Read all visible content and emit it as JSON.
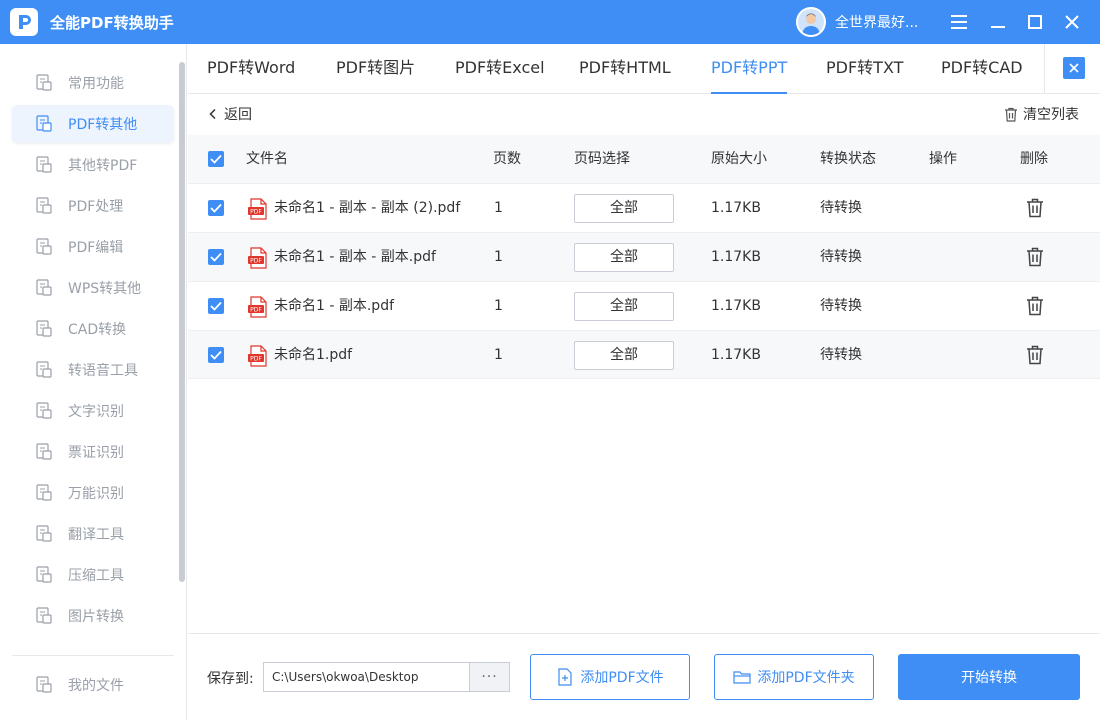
{
  "app": {
    "title": "全能PDF转换助手",
    "user_name": "全世界最好..."
  },
  "colors": {
    "accent": "#3e8ef5",
    "pdf_icon": "#e0362c"
  },
  "sidebar": {
    "items": [
      {
        "label": "常用功能",
        "icon": "star-grid-icon"
      },
      {
        "label": "PDF转其他",
        "icon": "convert-icon"
      },
      {
        "label": "其他转PDF",
        "icon": "file-to-pdf-icon"
      },
      {
        "label": "PDF处理",
        "icon": "pdf-process-icon"
      },
      {
        "label": "PDF编辑",
        "icon": "pdf-edit-icon"
      },
      {
        "label": "WPS转其他",
        "icon": "wps-icon"
      },
      {
        "label": "CAD转换",
        "icon": "cad-icon"
      },
      {
        "label": "转语音工具",
        "icon": "speech-icon"
      },
      {
        "label": "文字识别",
        "icon": "ocr-icon"
      },
      {
        "label": "票证识别",
        "icon": "ticket-icon"
      },
      {
        "label": "万能识别",
        "icon": "eye-icon"
      },
      {
        "label": "翻译工具",
        "icon": "translate-icon"
      },
      {
        "label": "压缩工具",
        "icon": "zip-icon"
      },
      {
        "label": "图片转换",
        "icon": "image-icon"
      }
    ],
    "bottom_item": {
      "label": "我的文件",
      "icon": "my-files-icon"
    }
  },
  "tabs": [
    {
      "label": "PDF转Word"
    },
    {
      "label": "PDF转图片"
    },
    {
      "label": "PDF转Excel"
    },
    {
      "label": "PDF转HTML"
    },
    {
      "label": "PDF转PPT"
    },
    {
      "label": "PDF转TXT"
    },
    {
      "label": "PDF转CAD"
    }
  ],
  "toolbar": {
    "back_label": "返回",
    "clear_label": "清空列表"
  },
  "table": {
    "headers": {
      "name": "文件名",
      "pages": "页数",
      "page_select": "页码选择",
      "size": "原始大小",
      "status": "转换状态",
      "action": "操作",
      "delete": "删除"
    },
    "rows": [
      {
        "name": "未命名1 - 副本 - 副本 (2).pdf",
        "pages": "1",
        "page_select": "全部",
        "size": "1.17KB",
        "status": "待转换"
      },
      {
        "name": "未命名1 - 副本 - 副本.pdf",
        "pages": "1",
        "page_select": "全部",
        "size": "1.17KB",
        "status": "待转换"
      },
      {
        "name": "未命名1 - 副本.pdf",
        "pages": "1",
        "page_select": "全部",
        "size": "1.17KB",
        "status": "待转换"
      },
      {
        "name": "未命名1.pdf",
        "pages": "1",
        "page_select": "全部",
        "size": "1.17KB",
        "status": "待转换"
      }
    ]
  },
  "footer": {
    "save_label": "保存到:",
    "save_path": "C:\\Users\\okwoa\\Desktop",
    "more_label": "···",
    "add_file_label": "添加PDF文件",
    "add_folder_label": "添加PDF文件夹",
    "start_label": "开始转换"
  }
}
